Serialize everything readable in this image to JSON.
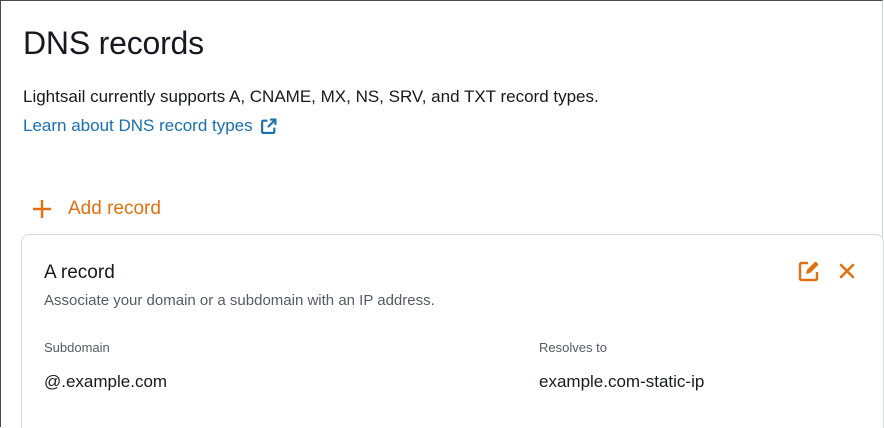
{
  "section": {
    "title": "DNS records",
    "description": "Lightsail currently supports A, CNAME, MX, NS, SRV, and TXT record types.",
    "learn_link": "Learn about DNS record types",
    "external_link_icon": "external-link-icon"
  },
  "actions": {
    "add_record": "Add record",
    "add_icon": "plus-icon"
  },
  "record": {
    "title": "A record",
    "description": "Associate your domain or a subdomain with an IP address.",
    "edit_icon": "edit-icon",
    "delete_icon": "close-icon",
    "fields": [
      {
        "label": "Subdomain",
        "value": "@.example.com"
      },
      {
        "label": "Resolves to",
        "value": "example.com-static-ip"
      }
    ]
  },
  "colors": {
    "accent_orange": "#e07010",
    "link_blue": "#1a6fb0",
    "text_primary": "#16191f",
    "text_secondary": "#545b64",
    "border": "#d5dbdb"
  }
}
